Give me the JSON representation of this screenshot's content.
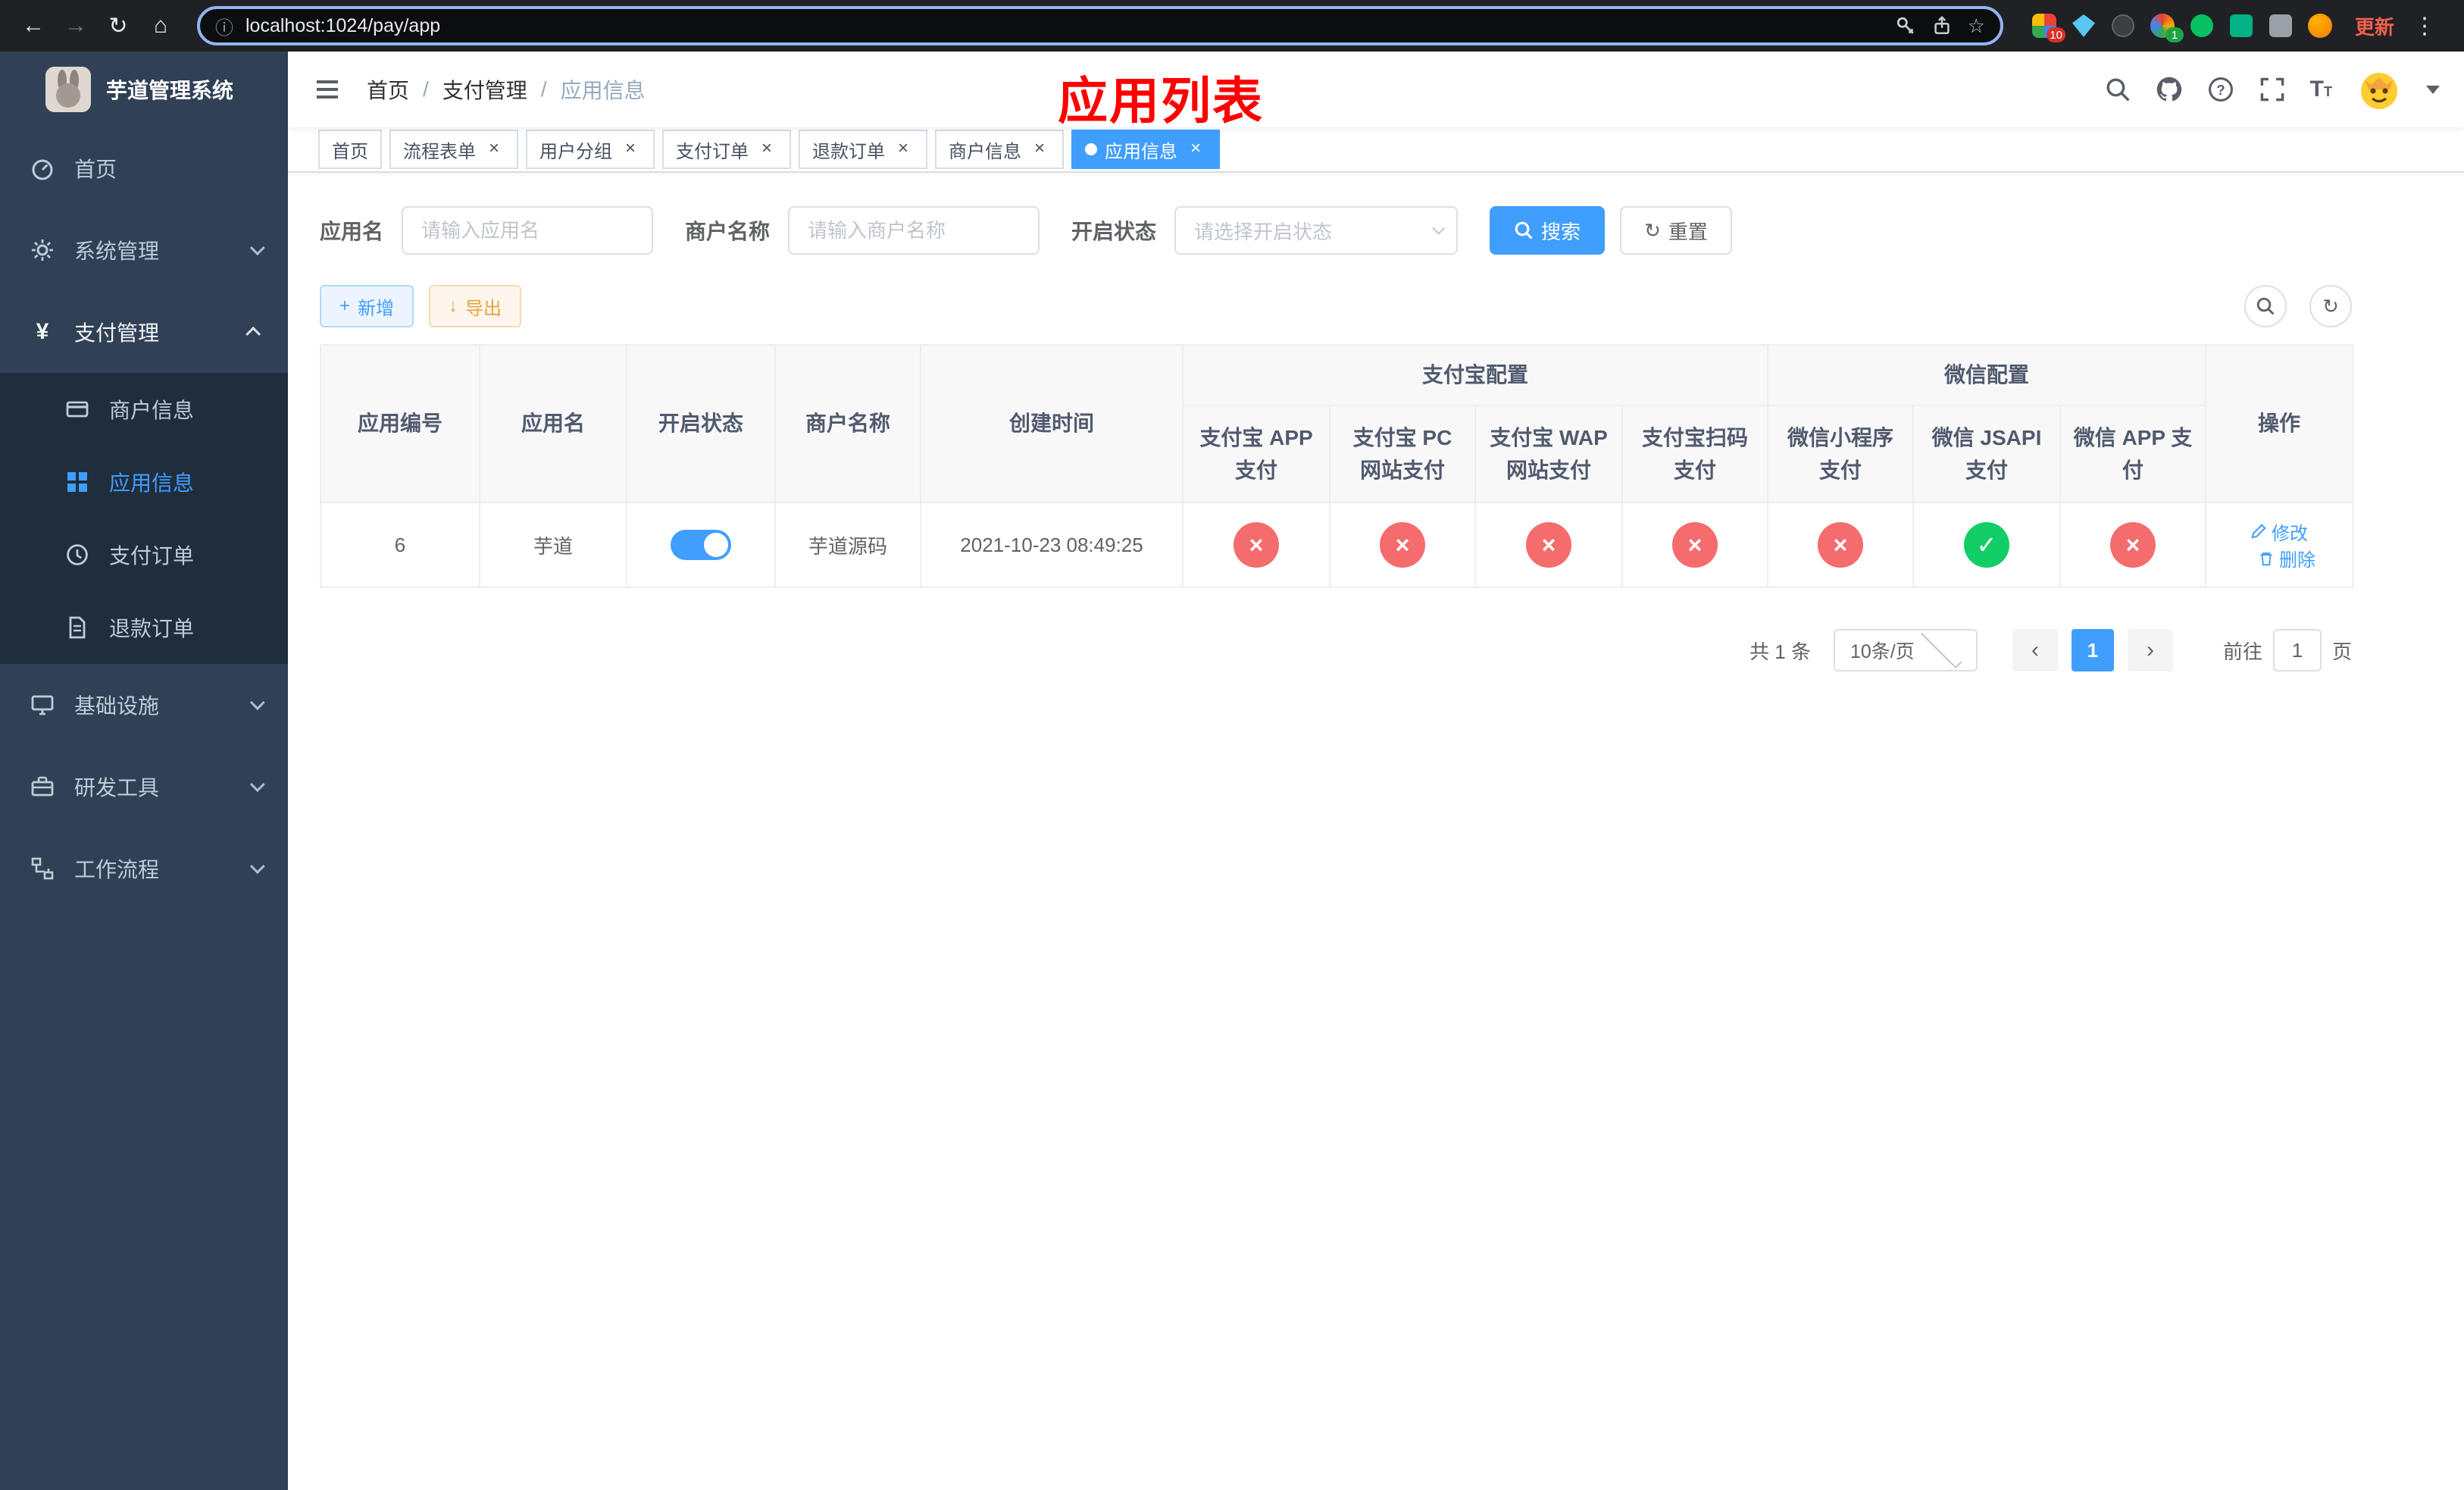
{
  "browser": {
    "url": "localhost:1024/pay/app",
    "update_label": "更新",
    "ext_badges": {
      "apps": "10",
      "avatar": "1"
    }
  },
  "icons": {
    "back": "←",
    "forward": "→",
    "reload": "↻",
    "home": "⌂",
    "info": "ⓘ",
    "star": "☆",
    "menu_dots": "⋮",
    "check": "✓",
    "cross": "×",
    "close": "×",
    "plus": "+",
    "download": "↓",
    "refresh": "↻",
    "prev": "‹",
    "next": "›",
    "yen": "¥"
  },
  "sidebar": {
    "title": "芋道管理系统",
    "menu": [
      {
        "label": "首页"
      },
      {
        "label": "系统管理"
      },
      {
        "label": "支付管理"
      },
      {
        "label": "商户信息"
      },
      {
        "label": "应用信息"
      },
      {
        "label": "支付订单"
      },
      {
        "label": "退款订单"
      },
      {
        "label": "基础设施"
      },
      {
        "label": "研发工具"
      },
      {
        "label": "工作流程"
      }
    ]
  },
  "navbar": {
    "breadcrumb": {
      "home": "首页",
      "parent": "支付管理",
      "current": "应用信息",
      "separator": "/"
    },
    "annotation": "应用列表"
  },
  "tabs": [
    {
      "label": "首页"
    },
    {
      "label": "流程表单"
    },
    {
      "label": "用户分组"
    },
    {
      "label": "支付订单"
    },
    {
      "label": "退款订单"
    },
    {
      "label": "商户信息"
    },
    {
      "label": "应用信息"
    }
  ],
  "filters": {
    "app_name": {
      "label": "应用名",
      "placeholder": "请输入应用名"
    },
    "merchant": {
      "label": "商户名称",
      "placeholder": "请输入商户名称"
    },
    "status": {
      "label": "开启状态",
      "placeholder": "请选择开启状态"
    },
    "search": "搜索",
    "reset": "重置"
  },
  "toolbar": {
    "add": "新增",
    "export": "导出"
  },
  "table": {
    "headers": {
      "app_id": "应用编号",
      "app_name": "应用名",
      "status": "开启状态",
      "merchant": "商户名称",
      "created": "创建时间",
      "alipay_group": "支付宝配置",
      "wechat_group": "微信配置",
      "alipay_app": "支付宝 APP 支付",
      "alipay_pc": "支付宝 PC 网站支付",
      "alipay_wap": "支付宝 WAP 网站支付",
      "alipay_qr": "支付宝扫码支付",
      "wechat_mini": "微信小程序支付",
      "wechat_jsapi": "微信 JSAPI 支付",
      "wechat_app": "微信 APP 支付",
      "ops": "操作"
    },
    "row": {
      "id": "6",
      "name": "芋道",
      "enabled": true,
      "merchant": "芋道源码",
      "created": "2021-10-23 08:49:25",
      "pay_status": [
        "off",
        "off",
        "off",
        "off",
        "off",
        "on",
        "off"
      ],
      "edit": "修改",
      "delete": "删除"
    }
  },
  "pagination": {
    "total": "共 1 条",
    "page_size": "10条/页",
    "page": "1",
    "goto_label": "前往",
    "goto_value": "1",
    "unit": "页"
  },
  "colors": {
    "primary": "#409eff",
    "danger": "#f56c6c",
    "success": "#13ce66",
    "warning": "#e6a23c",
    "annotation": "#ff0000",
    "sidebar_bg": "#304156",
    "submenu_bg": "#1f2d3d"
  }
}
